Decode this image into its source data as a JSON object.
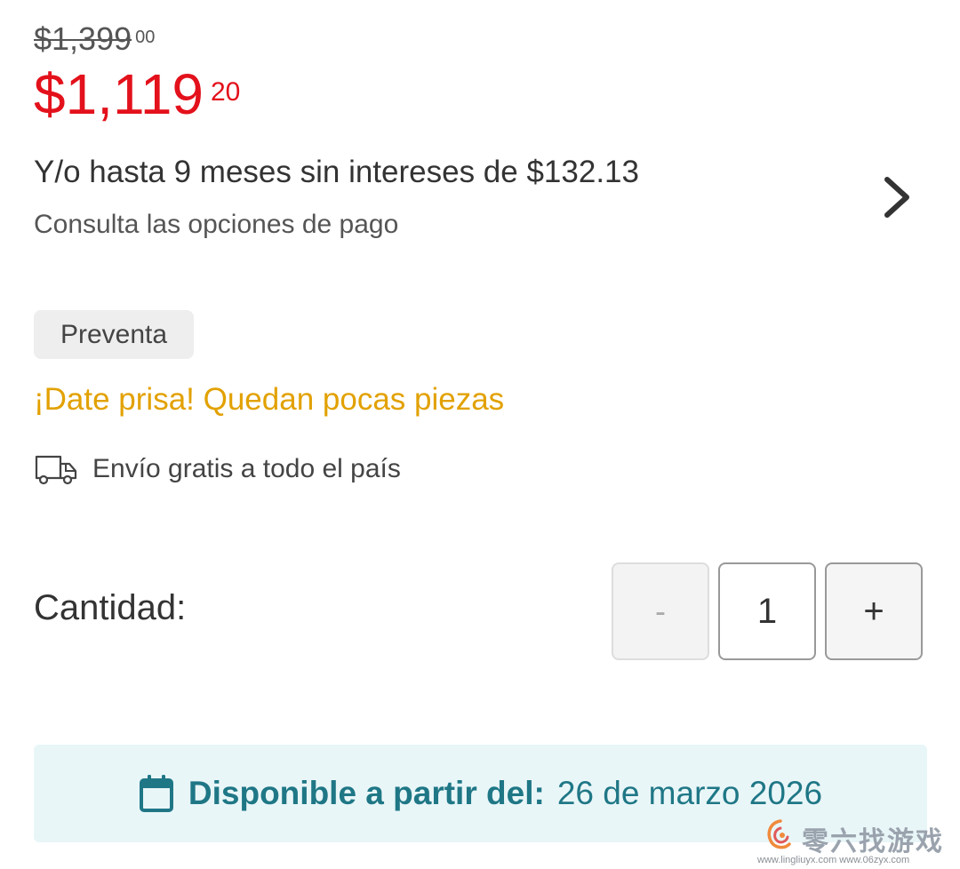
{
  "price": {
    "original_main": "$1,399",
    "original_cents": "00",
    "current_main": "$1,119",
    "current_cents": "20"
  },
  "installments": {
    "title": "Y/o hasta 9 meses sin intereses de $132.13",
    "subtitle": "Consulta las opciones de pago",
    "icon": "chevron-right-icon"
  },
  "badge": {
    "label": "Preventa"
  },
  "urgency": {
    "text": "¡Date prisa! Quedan pocas piezas",
    "color": "#e2a100"
  },
  "shipping": {
    "text": "Envío gratis a todo el país",
    "icon": "truck-icon"
  },
  "quantity": {
    "label": "Cantidad:",
    "decrement_label": "-",
    "value": "1",
    "increment_label": "+"
  },
  "availability": {
    "label": "Disponible a partir del:",
    "date": "26 de marzo 2026",
    "icon": "calendar-icon",
    "color": "#1f7786",
    "background": "#e9f6f8"
  },
  "watermark": {
    "title": "零六找游戏",
    "url": "www.lingliuyx.com   www.06zyx.com"
  },
  "colors": {
    "sale_red": "#e3111b",
    "text_dark": "#333333"
  }
}
